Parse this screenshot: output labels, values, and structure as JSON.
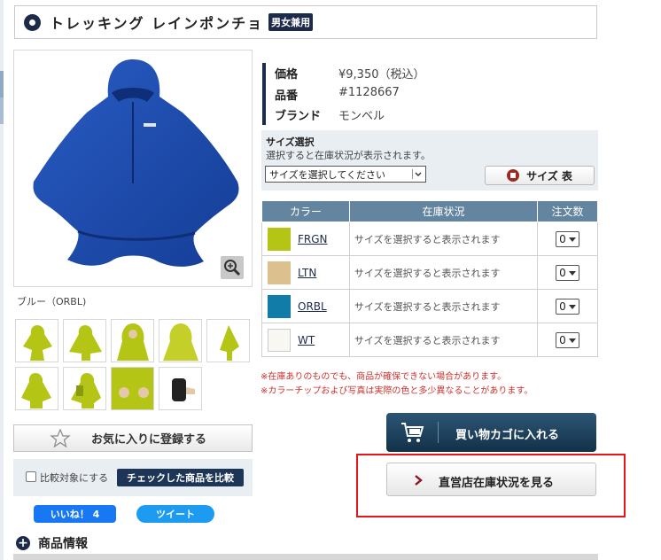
{
  "product": {
    "title": "トレッキング レインポンチョ",
    "badge": "男女兼用",
    "price_label": "価格",
    "price_value": "¥9,350（税込）",
    "code_label": "品番",
    "code_value": "#1128667",
    "brand_label": "ブランド",
    "brand_value": "モンベル"
  },
  "gallery": {
    "caption": "ブルー（ORBL)",
    "zoom_icon": "magnifier-plus-icon",
    "thumb_count": 10
  },
  "size": {
    "title": "サイズ選択",
    "note": "選択すると在庫状況が表示されます。",
    "select_placeholder": "サイズを選択してください",
    "size_table_label": "サイズ 表"
  },
  "color_table": {
    "headers": [
      "カラー",
      "在庫状況",
      "注文数"
    ],
    "rows": [
      {
        "code": "FRGN",
        "color": "#b5c516",
        "stock": "サイズを選択すると表示されます",
        "qty": "0"
      },
      {
        "code": "LTN",
        "color": "#dcc08e",
        "stock": "サイズを選択すると表示されます",
        "qty": "0"
      },
      {
        "code": "ORBL",
        "color": "#127ca8",
        "stock": "サイズを選択すると表示されます",
        "qty": "0"
      },
      {
        "code": "WT",
        "color": "#f8f7f2",
        "stock": "サイズを選択すると表示されます",
        "qty": "0"
      }
    ]
  },
  "notes": [
    "※在庫ありのものでも、商品が確保できない場合があります。",
    "※カラーチップおよび写真は実際の色と多少異なることがあります。"
  ],
  "actions": {
    "favorite_label": "お気に入りに登録する",
    "compare_label": "比較対象にする",
    "compare_button": "チェックした商品を比較",
    "like_label": "いいね！ 4",
    "tweet_label": "ツイート",
    "cart_label": "買い物カゴに入れる",
    "store_stock_label": "直営店在庫状況を見る"
  },
  "section": {
    "product_info": "商品情報"
  },
  "colors": {
    "navy": "#1d2b4a",
    "table_header": "#64859f",
    "highlight": "#e2171e",
    "note_red": "#d0312d"
  }
}
